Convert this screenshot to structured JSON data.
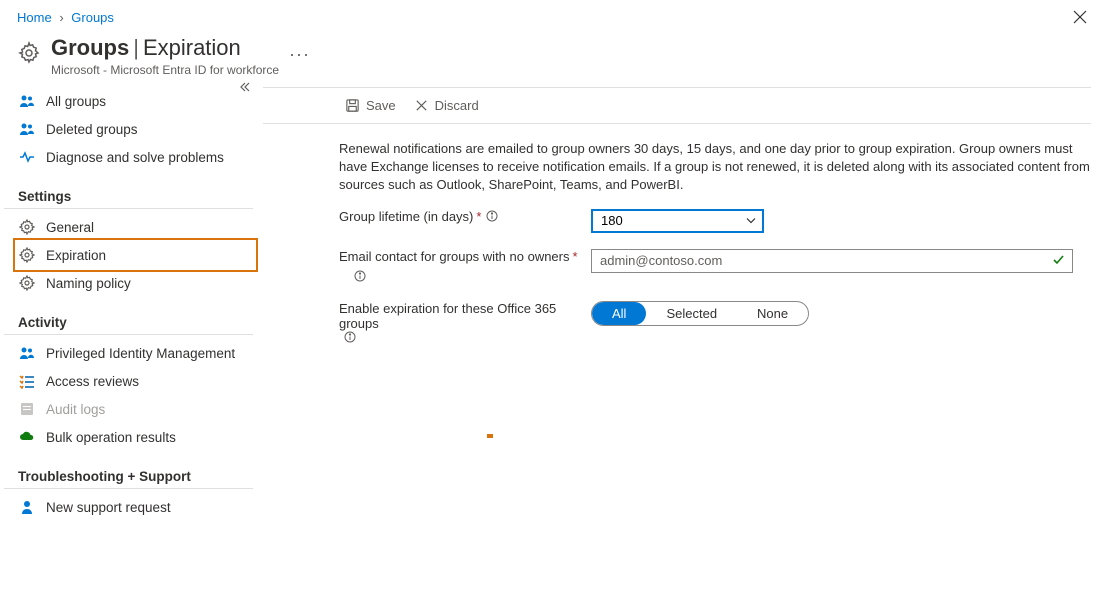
{
  "breadcrumb": {
    "home": "Home",
    "groups": "Groups"
  },
  "header": {
    "title_main": "Groups",
    "title_sub": "Expiration",
    "subtitle": "Microsoft - Microsoft Entra ID for workforce"
  },
  "toolbar": {
    "save": "Save",
    "discard": "Discard"
  },
  "sidebar": {
    "items": [
      {
        "label": "All groups"
      },
      {
        "label": "Deleted groups"
      },
      {
        "label": "Diagnose and solve problems"
      }
    ],
    "settings_head": "Settings",
    "settings": [
      {
        "label": "General"
      },
      {
        "label": "Expiration"
      },
      {
        "label": "Naming policy"
      }
    ],
    "activity_head": "Activity",
    "activity": [
      {
        "label": "Privileged Identity Management"
      },
      {
        "label": "Access reviews"
      },
      {
        "label": "Audit logs"
      },
      {
        "label": "Bulk operation results"
      }
    ],
    "support_head": "Troubleshooting + Support",
    "support": [
      {
        "label": "New support request"
      }
    ]
  },
  "content": {
    "description": "Renewal notifications are emailed to group owners 30 days, 15 days, and one day prior to group expiration. Group owners must have Exchange licenses to receive notification emails. If a group is not renewed, it is deleted along with its associated content from sources such as Outlook, SharePoint, Teams, and PowerBI.",
    "lifetime_label": "Group lifetime (in days)",
    "lifetime_value": "180",
    "email_label": "Email contact for groups with no owners",
    "email_value": "admin@contoso.com",
    "enable_label": "Enable expiration for these Office 365 groups",
    "toggle": {
      "all": "All",
      "selected": "Selected",
      "none": "None"
    }
  }
}
